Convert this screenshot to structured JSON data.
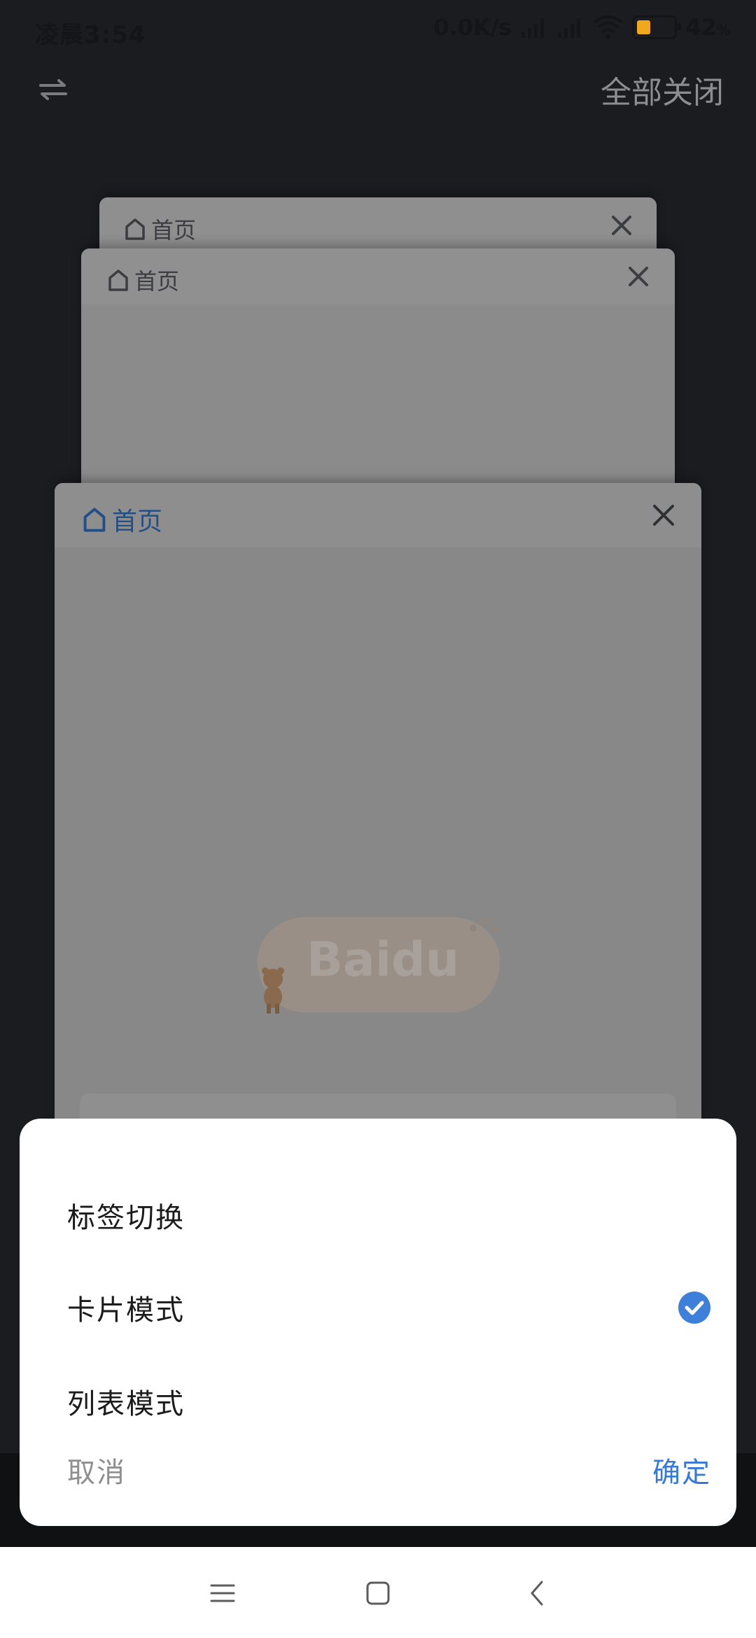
{
  "status_bar": {
    "time": "凌晨3:54",
    "net_speed": "0.0K/s",
    "battery_percent": "42",
    "battery_unit": "%",
    "battery_level": 0.42,
    "battery_color": "#f0a81e"
  },
  "header": {
    "switch_icon": "switch-arrows-icon",
    "close_all_label": "全部关闭"
  },
  "tabs": [
    {
      "title": "首页"
    },
    {
      "title": "首页"
    },
    {
      "title": "首页",
      "active": true
    }
  ],
  "active_tab": {
    "logo_text": "Baidu"
  },
  "dialog": {
    "options": [
      {
        "label": "标签切换",
        "selected": false
      },
      {
        "label": "卡片模式",
        "selected": true
      },
      {
        "label": "列表模式",
        "selected": false
      }
    ],
    "cancel_label": "取消",
    "confirm_label": "确定",
    "accent_color": "#3779d3"
  },
  "nav_bar": {
    "buttons": [
      "menu-icon",
      "home-square-icon",
      "back-chevron-icon"
    ]
  }
}
